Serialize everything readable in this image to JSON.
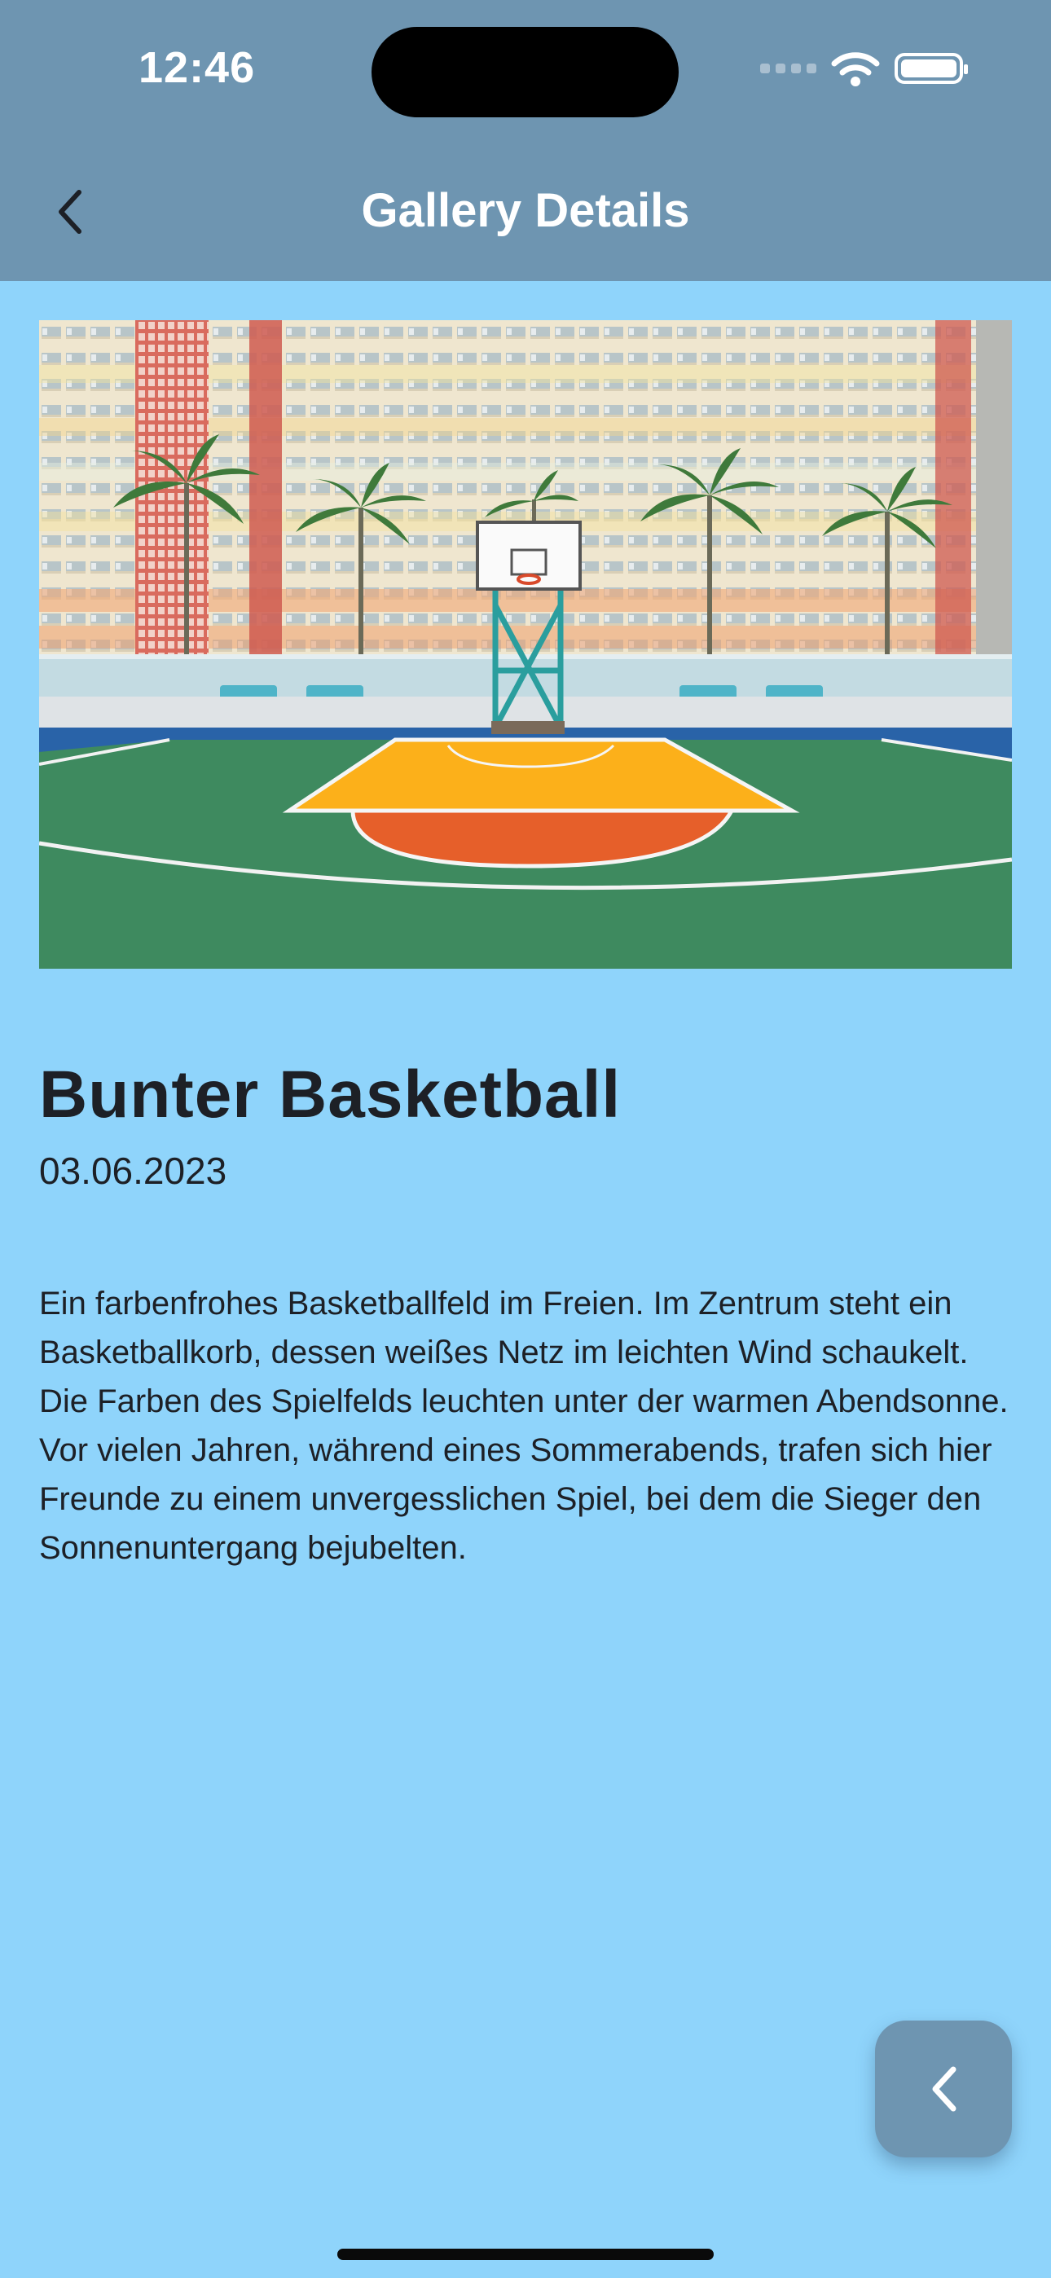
{
  "status_bar": {
    "time": "12:46"
  },
  "nav": {
    "title": "Gallery Details",
    "back_icon": "chevron-left-icon"
  },
  "gallery_item": {
    "image_alt": "Colorful outdoor basketball court in front of a pastel apartment block",
    "title": "Bunter Basketball",
    "date": "03.06.2023",
    "description": "Ein farbenfrohes Basketballfeld im Freien. Im Zentrum steht ein Basketballkorb, dessen weißes Netz im leichten Wind schaukelt. Die Farben des Spielfelds leuchten unter der warmen Abendsonne. Vor vielen Jahren, während eines Sommerabends, trafen sich hier Freunde zu einem unvergesslichen Spiel, bei dem die Sieger den Sonnenuntergang bejubelten."
  },
  "fab": {
    "icon": "chevron-left-icon"
  },
  "colors": {
    "background": "#8fd4fb",
    "header": "#6e95b1",
    "text": "#1d2026",
    "header_text": "#ffffff"
  }
}
